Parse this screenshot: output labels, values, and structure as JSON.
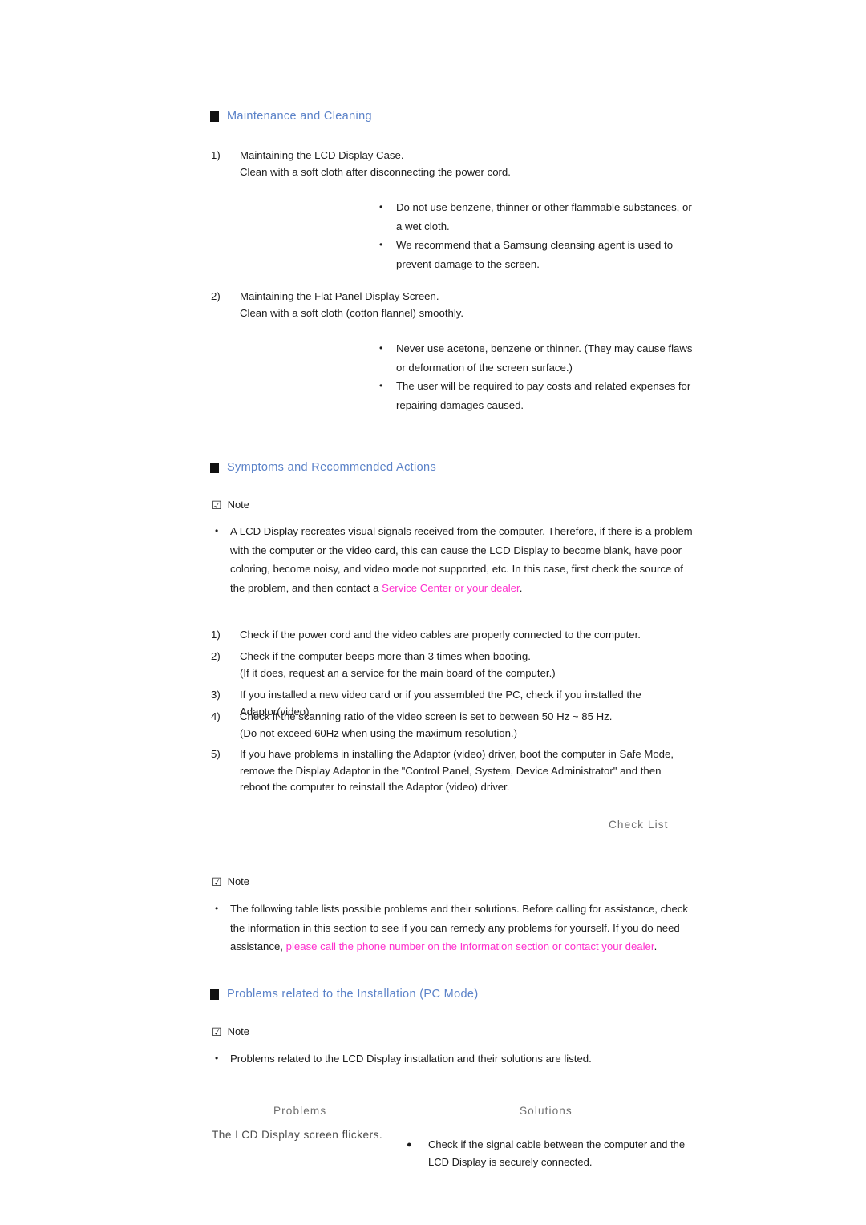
{
  "document": {
    "sections": [
      {
        "heading": "Maintenance and Cleaning",
        "items": [
          {
            "number": "1)",
            "line1": "Maintaining the LCD Display Case.",
            "line2": "Clean with a soft cloth after disconnecting the power cord."
          },
          {
            "number": "2)",
            "line1": "Maintaining the Flat Panel Display Screen.",
            "line2": "Clean with a soft cloth (cotton flannel) smoothly."
          }
        ],
        "bullets_group_1": [
          "Do not use benzene, thinner or other flammable substances, or a wet cloth.",
          "We recommend that a Samsung cleansing agent is used to prevent damage to the screen."
        ],
        "bullets_group_2": [
          "Never use acetone, benzene or thinner. (They may cause flaws or deformation of the screen surface.)",
          "The user will be required to pay costs and related expenses for repairing damages caused."
        ]
      },
      {
        "heading": "Symptoms and Recommended Actions",
        "note_label": "Note",
        "note_icon": "checkbox-checked-icon",
        "note_paragraph_pre": "A LCD Display recreates visual signals received from the computer. Therefore, if there is a problem with the computer or the video card, this can cause the LCD Display to become blank, have poor coloring, become noisy, and video mode not supported, etc. In this case, first check the source of the problem, and then contact a ",
        "note_paragraph_link": "Service Center or your dealer",
        "note_paragraph_post": ".",
        "checks": [
          {
            "number": "1)",
            "line1": "Check if the power cord and the video cables are properly connected to the computer.",
            "line2": ""
          },
          {
            "number": "2)",
            "line1": "Check if the computer beeps more than 3 times when booting.",
            "line2": "(If it does, request an a service for the main board of the computer.)"
          },
          {
            "number": "3)",
            "line1": "If you installed a new video card or if you assembled the PC, check if you installed the Adaptor(video).",
            "line2": ""
          },
          {
            "number": "4)",
            "line1": "Check if the scanning ratio of the video screen is set to between 50 Hz ~ 85 Hz.",
            "line2": "(Do not exceed 60Hz when using the maximum resolution.)"
          },
          {
            "number": "5)",
            "line1": "If you have problems in installing the Adaptor (video) driver, boot the computer in Safe Mode, remove the Display Adaptor in the \"Control Panel, System, Device Administrator\" and then reboot the computer to reinstall the Adaptor (video) driver.",
            "line2": ""
          }
        ],
        "check_list_label": "Check List",
        "note2_label": "Note",
        "note2_icon": "checkbox-checked-icon",
        "note2_paragraph_pre": "The following table lists possible problems and their solutions. Before calling for assistance, check the information in this section to see if you can remedy any problems for yourself. If you do need assistance, ",
        "note2_paragraph_link": "please call the phone number on the Information section or contact your dealer",
        "note2_paragraph_post": "."
      },
      {
        "heading": "Problems related to the Installation (PC Mode)",
        "note_label": "Note",
        "note_icon": "checkbox-checked-icon",
        "note_paragraph": "Problems related to the LCD Display installation and their solutions are listed.",
        "table": {
          "headers": [
            "Problems",
            "Solutions"
          ],
          "rows": [
            {
              "problem": "The LCD Display screen flickers.",
              "solution": "Check if the signal cable between the computer and the LCD Display is securely connected."
            }
          ]
        }
      }
    ],
    "colors": {
      "heading_blue": "#5b82c8",
      "link_pink": "#ff2ecc",
      "gray_label": "#6f6f6f",
      "body_text": "#1c1c1c"
    },
    "glyphs": {
      "bullet_small": "•",
      "bullet_large": "●",
      "checkbox_checked": "☑"
    }
  }
}
